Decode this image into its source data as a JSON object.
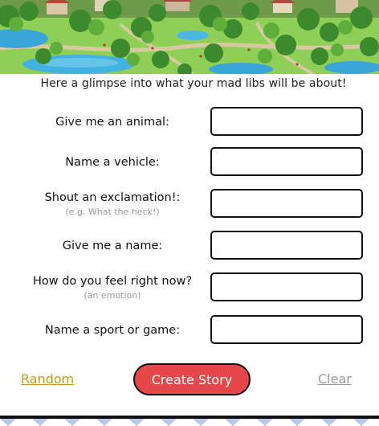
{
  "banner": {
    "image_icon": "park-illustration"
  },
  "intro": {
    "text": "Here a glimpse into what your mad libs will be about!"
  },
  "form": {
    "fields": [
      {
        "label": "Give me an animal:",
        "hint": "",
        "value": ""
      },
      {
        "label": "Name a vehicle:",
        "hint": "",
        "value": ""
      },
      {
        "label": "Shout an exclamation!:",
        "hint": "(e.g. What the heck!)",
        "value": ""
      },
      {
        "label": "Give me a name:",
        "hint": "",
        "value": ""
      },
      {
        "label": "How do you feel right now?",
        "hint": "(an emotion)",
        "value": ""
      },
      {
        "label": "Name a sport or game:",
        "hint": "",
        "value": ""
      }
    ]
  },
  "actions": {
    "random_label": "Random",
    "create_label": "Create Story",
    "clear_label": "Clear"
  },
  "colors": {
    "accent": "#e5474b",
    "random_link": "#c59a1f",
    "clear_link": "#9a9a9a"
  }
}
